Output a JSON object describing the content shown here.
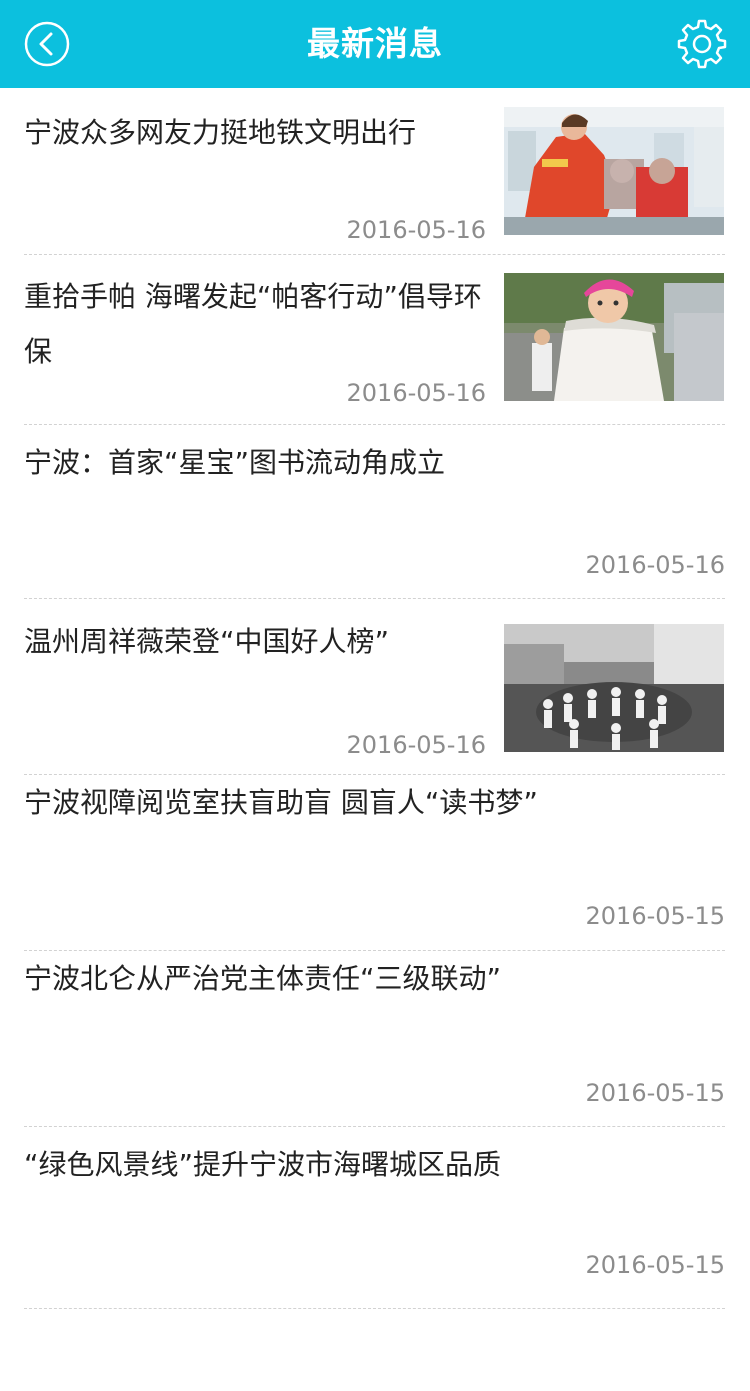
{
  "header": {
    "title": "最新消息",
    "back_icon": "chevron-left-circle-icon",
    "settings_icon": "gear-icon",
    "accent_color": "#0cc0de"
  },
  "news": [
    {
      "title": "宁波众多网友力挺地铁文明出行",
      "date": "2016-05-16",
      "thumbnail": "subway-volunteer-photo"
    },
    {
      "title": "重拾手帕 海曙发起“帕客行动”倡导环保",
      "date": "2016-05-16",
      "thumbnail": "child-with-bag-photo"
    },
    {
      "title": "宁波：首家“星宝”图书流动角成立",
      "date": "2016-05-16"
    },
    {
      "title": "温州周祥薇荣登“中国好人榜”",
      "date": "2016-05-16",
      "thumbnail": "children-circle-bw-photo"
    },
    {
      "title": "宁波视障阅览室扶盲助盲 圆盲人“读书梦”",
      "date": "2016-05-15"
    },
    {
      "title": "宁波北仑从严治党主体责任“三级联动”",
      "date": "2016-05-15"
    },
    {
      "title": "“绿色风景线”提升宁波市海曙城区品质",
      "date": "2016-05-15"
    }
  ]
}
